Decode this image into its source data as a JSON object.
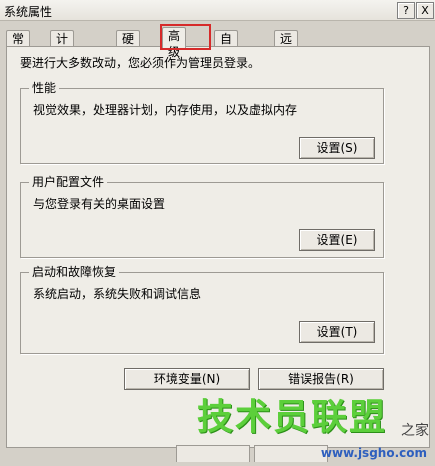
{
  "window": {
    "title": "系统属性",
    "help_button": "?",
    "close_button": "X"
  },
  "tabs": [
    {
      "label": "常规"
    },
    {
      "label": "计算机名"
    },
    {
      "label": "硬件"
    },
    {
      "label": "高级"
    },
    {
      "label": "自动更新"
    },
    {
      "label": "远程"
    }
  ],
  "active_tab": "高级",
  "admin_notice": "要进行大多数改动，您必须作为管理员登录。",
  "groups": {
    "performance": {
      "title": "性能",
      "description": "视觉效果，处理器计划，内存使用，以及虚拟内存",
      "button": "设置(S)"
    },
    "user_profiles": {
      "title": "用户配置文件",
      "description": "与您登录有关的桌面设置",
      "button": "设置(E)"
    },
    "startup_recovery": {
      "title": "启动和故障恢复",
      "description": "系统启动，系统失败和调试信息",
      "button": "设置(T)"
    }
  },
  "buttons": {
    "env_vars": "环境变量(N)",
    "error_report": "错误报告(R)"
  },
  "watermark": {
    "main": "技术员联盟",
    "side": "之家",
    "url": "www.jsgho.com"
  },
  "colors": {
    "highlight": "#d62a2a",
    "watermark_green": "#5ccf3b"
  }
}
